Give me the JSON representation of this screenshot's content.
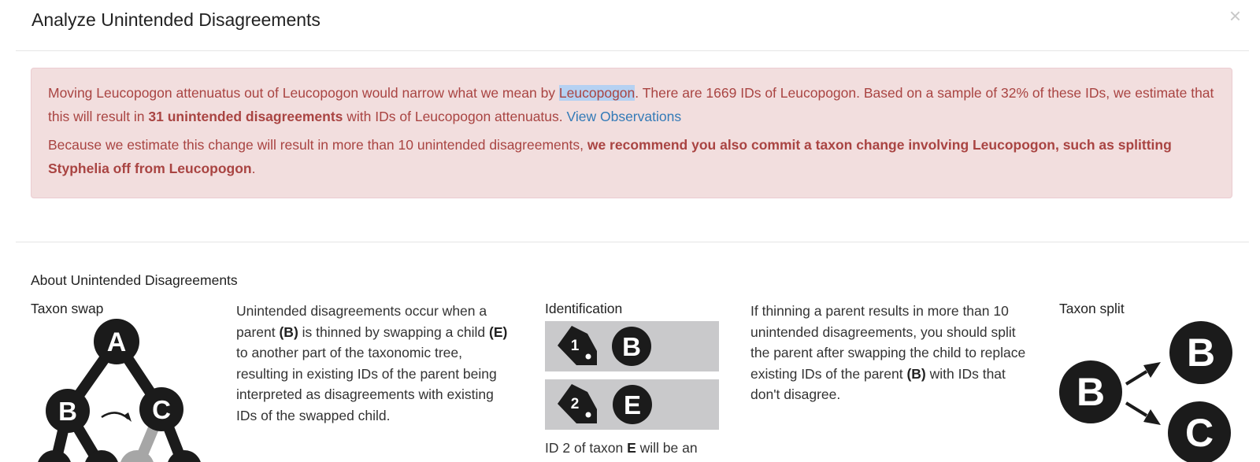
{
  "modal": {
    "title": "Analyze Unintended Disagreements",
    "close_label": "×"
  },
  "alert": {
    "p1_a": "Moving Leucopogon attenuatus out of Leucopogon would narrow what we mean by ",
    "p1_highlight": "Leucopogon",
    "p1_b": ". There are 1669 IDs of Leucopogon. Based on a sample of 32% of these IDs, we estimate that this will result in ",
    "p1_bold": "31 unintended disagreements",
    "p1_c": " with IDs of Leucopogon attenuatus. ",
    "link": "View Observations",
    "p2_a": "Because we estimate this change will result in more than 10 unintended disagreements, ",
    "p2_bold": "we recommend you also commit a taxon change involving Leucopogon, such as splitting Styphelia off from Leucopogon",
    "p2_b": "."
  },
  "about": {
    "title": "About Unintended Disagreements",
    "swap": {
      "heading": "Taxon swap",
      "nodes": [
        "A",
        "B",
        "C"
      ]
    },
    "description": {
      "t1": "Unintended disagreements occur when a parent ",
      "b1": "(B)",
      "t2": " is thinned by swapping a child ",
      "b2": "(E)",
      "t3": " to another part of the taxonomic tree, resulting in existing IDs of the parent being interpreted as disagreements with existing IDs of the swapped child."
    },
    "identification": {
      "heading": "Identification",
      "cards": [
        {
          "tag": "1",
          "taxon": "B"
        },
        {
          "tag": "2",
          "taxon": "E"
        }
      ],
      "caption_a": "ID 2 of taxon ",
      "caption_b": "E",
      "caption_c": " will be an"
    },
    "thinning": {
      "t1": "If thinning a parent results in more than 10 unintended disagreements, you should split the parent after swapping the child to replace existing IDs of the parent ",
      "b1": "(B)",
      "t2": " with IDs that don't disagree."
    },
    "split": {
      "heading": "Taxon split",
      "nodes": [
        "B",
        "B",
        "C"
      ]
    }
  },
  "colors": {
    "alert_bg": "#f2dede",
    "alert_text": "#a94442",
    "link": "#337ab7",
    "highlight": "#b5d1f2",
    "node_fill": "#1b1b1b",
    "card_bg": "#c9c9cb"
  }
}
